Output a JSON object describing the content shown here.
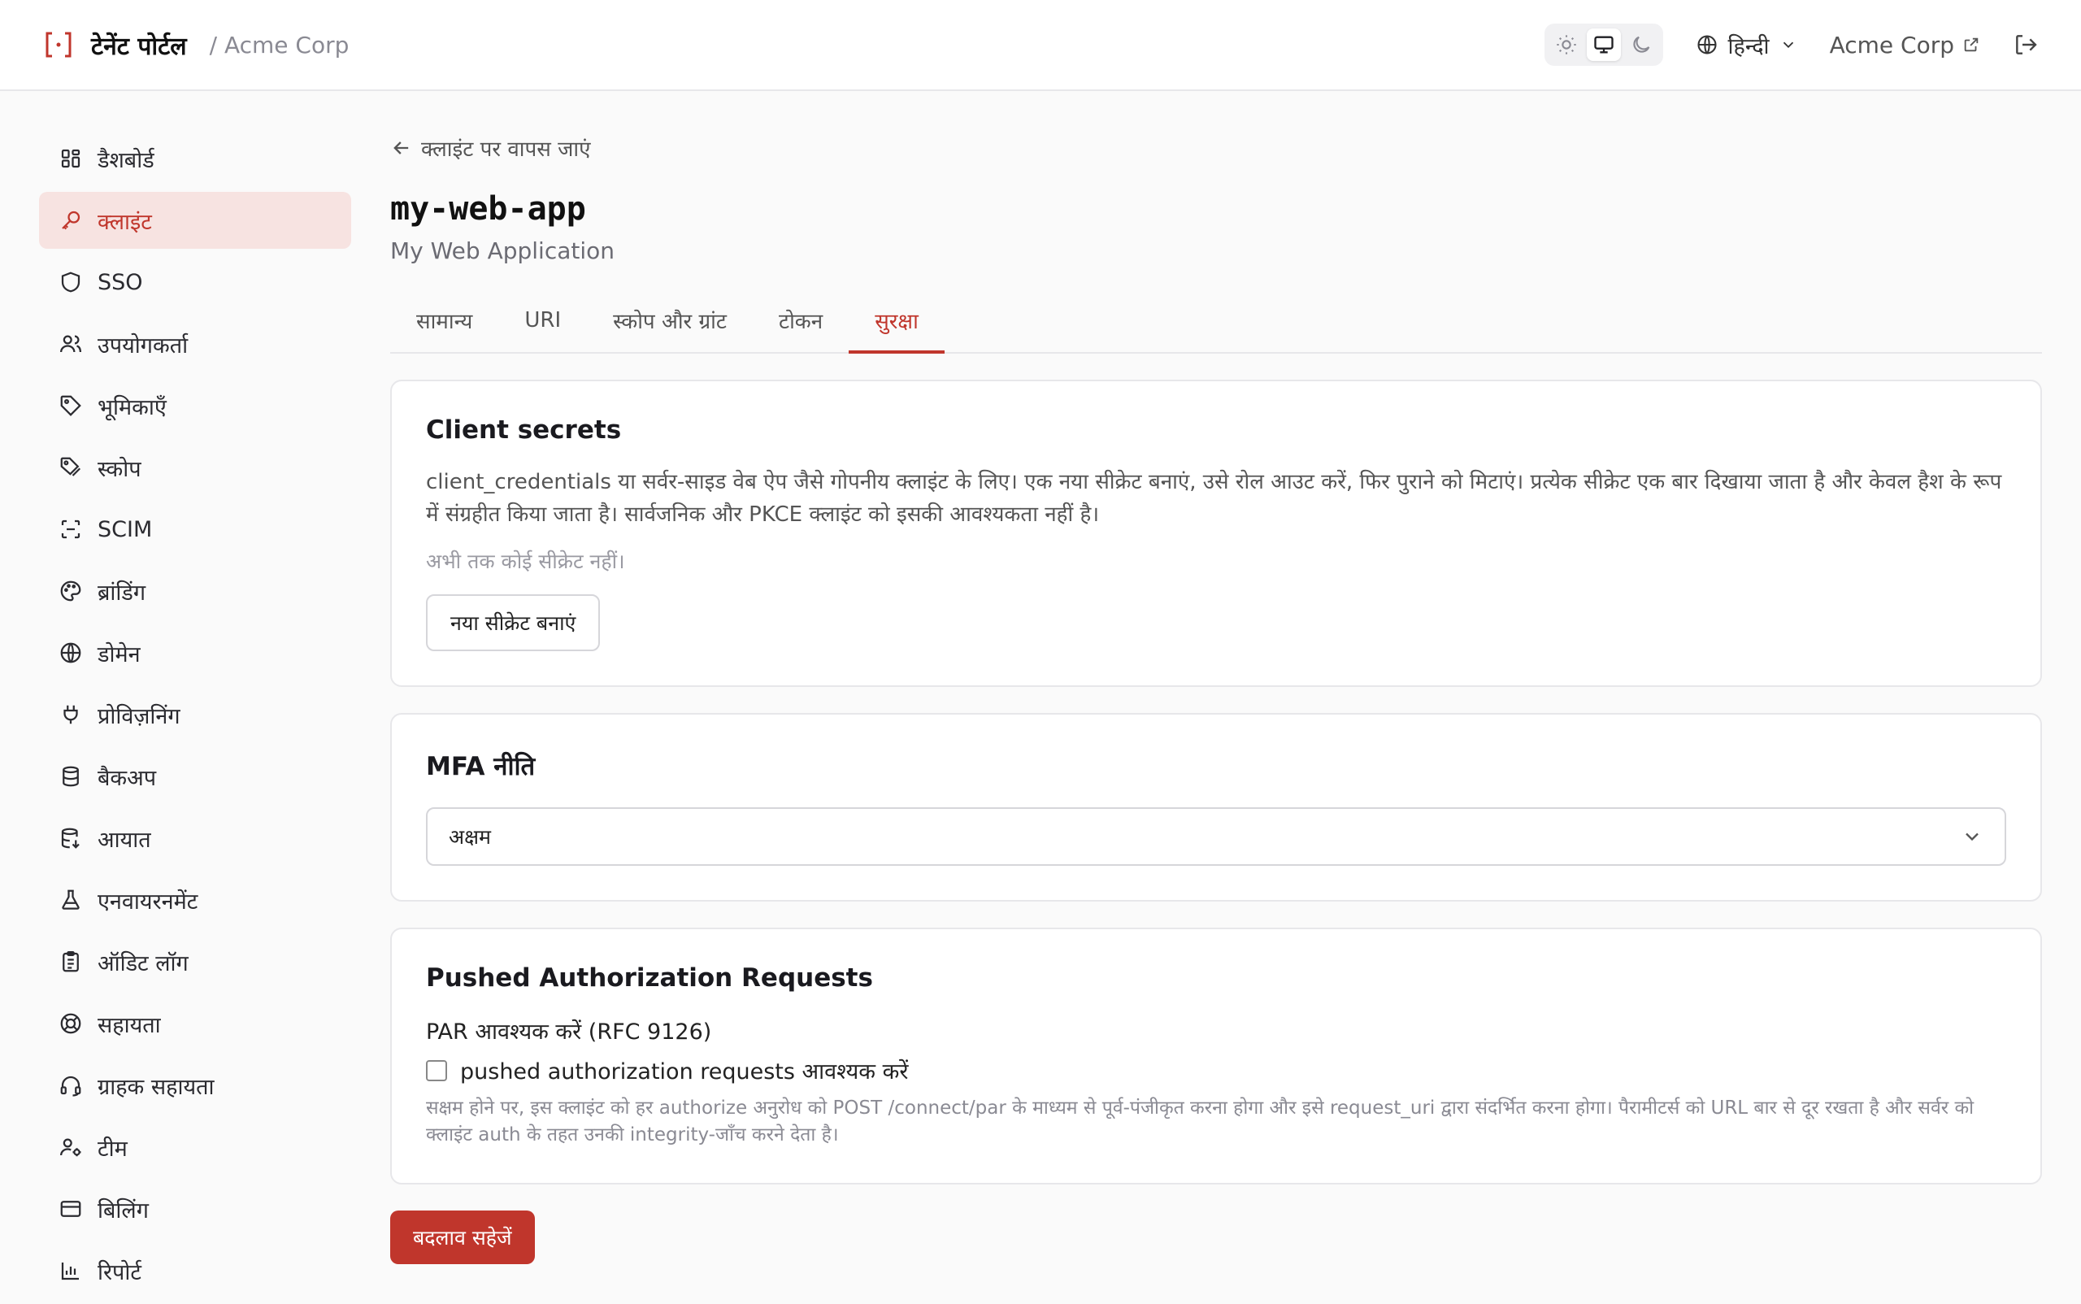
{
  "header": {
    "title": "टेनेंट पोर्टल",
    "org_crumb": "/ Acme Corp",
    "language": "हिन्दी",
    "org_link": "Acme Corp"
  },
  "theme": {
    "options": [
      "light",
      "system",
      "dark"
    ],
    "active": "system"
  },
  "sidebar": {
    "items": [
      {
        "label": "डैशबोर्ड",
        "icon": "dashboard-icon"
      },
      {
        "label": "क्लाइंट",
        "icon": "key-icon",
        "active": true
      },
      {
        "label": "SSO",
        "icon": "shield-icon"
      },
      {
        "label": "उपयोगकर्ता",
        "icon": "users-icon"
      },
      {
        "label": "भूमिकाएँ",
        "icon": "tag-icon"
      },
      {
        "label": "स्कोप",
        "icon": "tags-icon"
      },
      {
        "label": "SCIM",
        "icon": "scan-icon"
      },
      {
        "label": "ब्रांडिंग",
        "icon": "palette-icon"
      },
      {
        "label": "डोमेन",
        "icon": "globe-icon"
      },
      {
        "label": "प्रोविज़निंग",
        "icon": "plug-icon"
      },
      {
        "label": "बैकअप",
        "icon": "database-icon"
      },
      {
        "label": "आयात",
        "icon": "database-import-icon"
      },
      {
        "label": "एनवायरनमेंट",
        "icon": "flask-icon"
      },
      {
        "label": "ऑडिट लॉग",
        "icon": "clipboard-icon"
      },
      {
        "label": "सहायता",
        "icon": "lifebuoy-icon"
      },
      {
        "label": "ग्राहक सहायता",
        "icon": "headset-icon"
      },
      {
        "label": "टीम",
        "icon": "user-cog-icon"
      },
      {
        "label": "बिलिंग",
        "icon": "credit-card-icon"
      },
      {
        "label": "रिपोर्ट",
        "icon": "bar-chart-icon"
      }
    ]
  },
  "main": {
    "back_label": "क्लाइंट पर वापस जाएं",
    "client_id": "my-web-app",
    "client_name": "My Web Application",
    "tabs": [
      {
        "label": "सामान्य"
      },
      {
        "label": "URI"
      },
      {
        "label": "स्कोप और ग्रांट"
      },
      {
        "label": "टोकन"
      },
      {
        "label": "सुरक्षा",
        "active": true
      }
    ],
    "secrets": {
      "title": "Client secrets",
      "description": "client_credentials या सर्वर-साइड वेब ऐप जैसे गोपनीय क्लाइंट के लिए। एक नया सीक्रेट बनाएं, उसे रोल आउट करें, फिर पुराने को मिटाएं। प्रत्येक सीक्रेट एक बार दिखाया जाता है और केवल हैश के रूप में संग्रहीत किया जाता है। सार्वजनिक और PKCE क्लाइंट को इसकी आवश्यकता नहीं है।",
      "empty": "अभी तक कोई सीक्रेट नहीं।",
      "new_button": "नया सीक्रेट बनाएं"
    },
    "mfa": {
      "title": "MFA नीति",
      "selected": "अक्षम"
    },
    "par": {
      "title": "Pushed Authorization Requests",
      "label": "PAR आवश्यक करें (RFC 9126)",
      "checkbox_label": "pushed authorization requests आवश्यक करें",
      "checked": false,
      "hint": "सक्षम होने पर, इस क्लाइंट को हर authorize अनुरोध को POST /connect/par के माध्यम से पूर्व-पंजीकृत करना होगा और इसे request_uri द्वारा संदर्भित करना होगा। पैरामीटर्स को URL बार से दूर रखता है और सर्वर को क्लाइंट auth के तहत उनकी integrity-जाँच करने देता है।"
    },
    "save_button": "बदलाव सहेजें"
  },
  "colors": {
    "accent": "#c0362c",
    "accent_bg": "#f7e3e1"
  }
}
